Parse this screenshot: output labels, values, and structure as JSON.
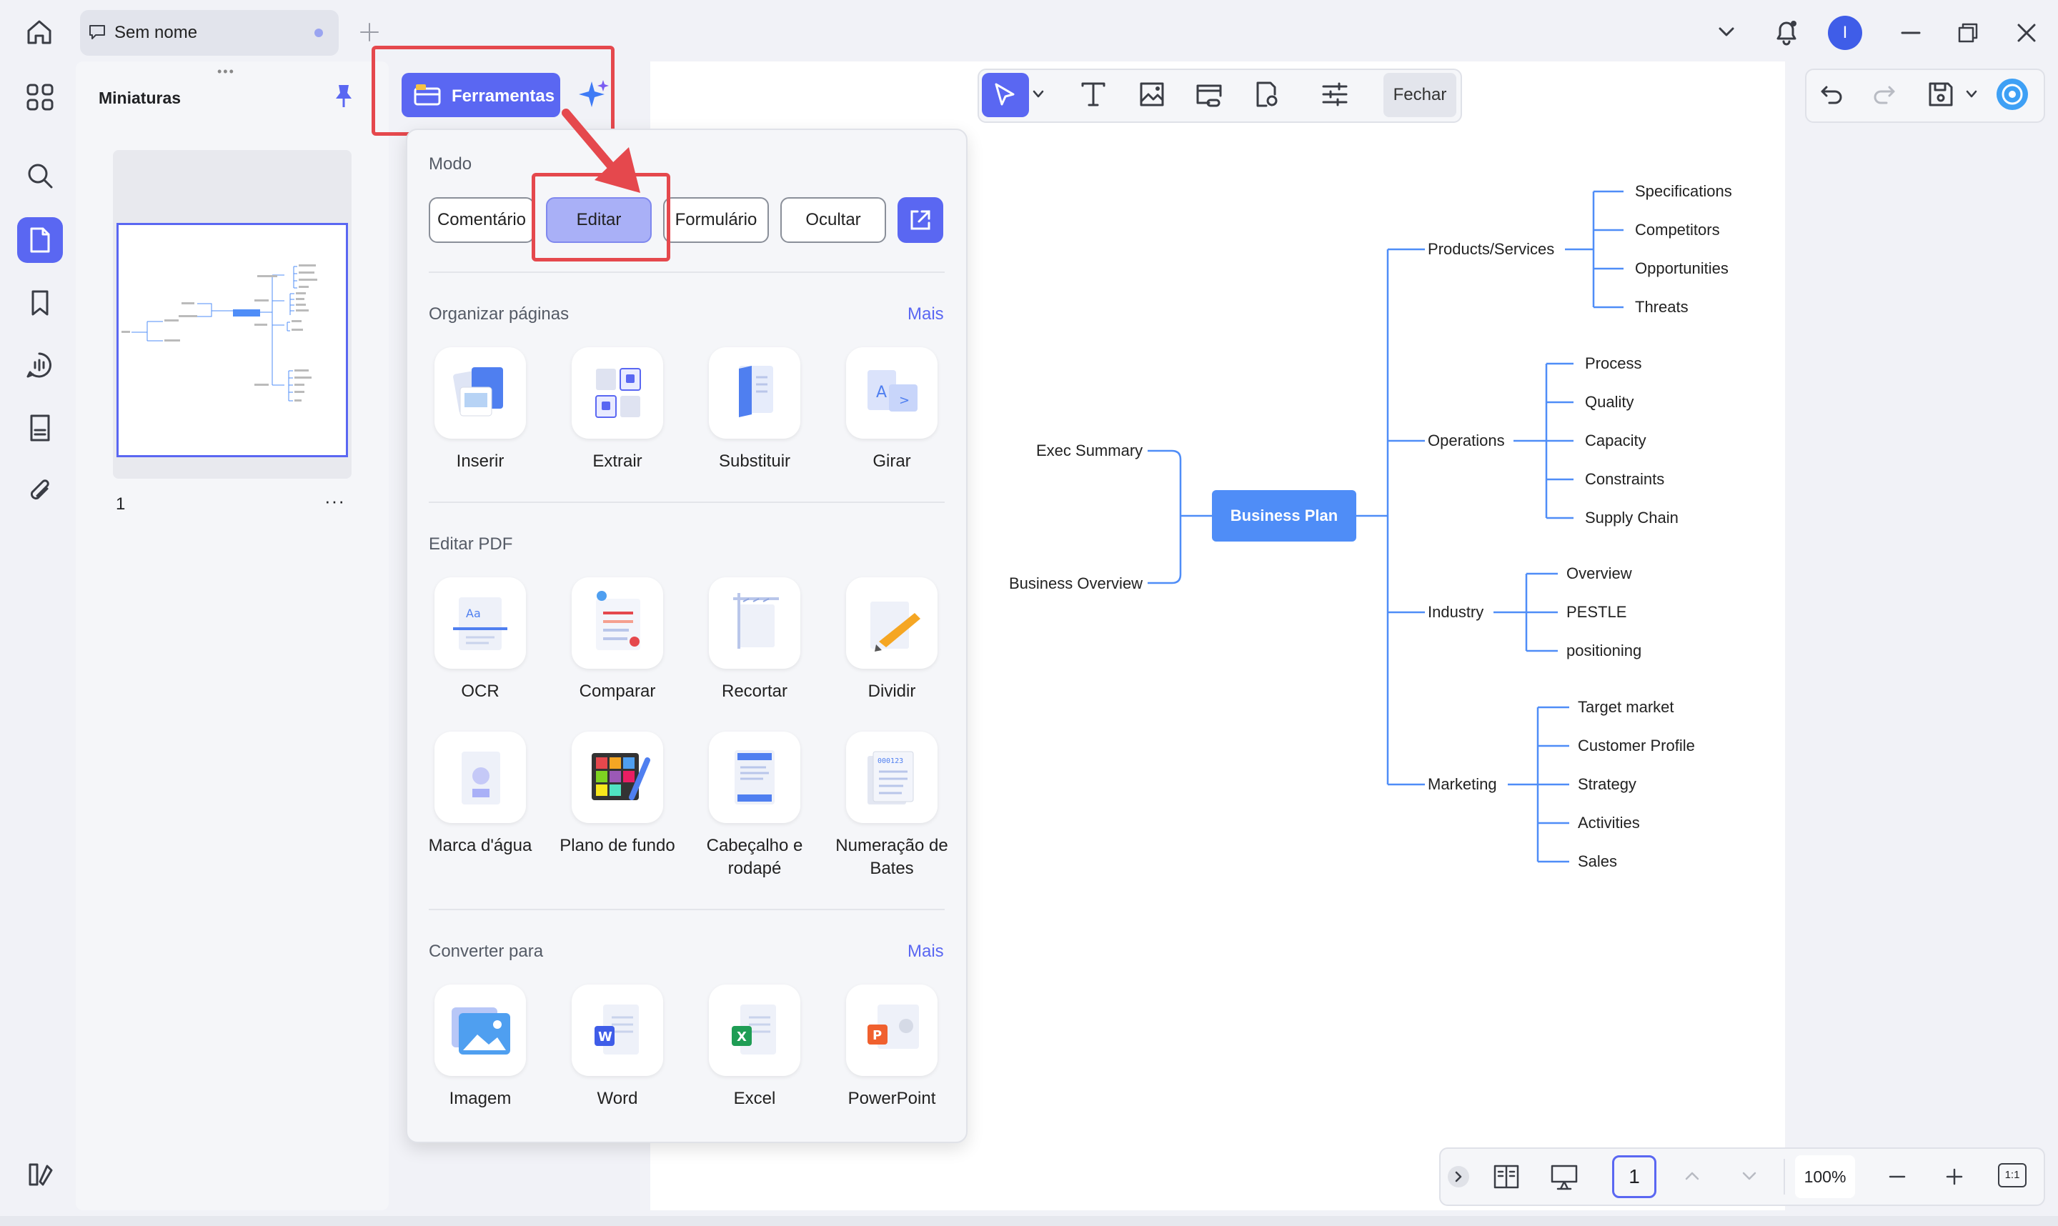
{
  "tab": {
    "title": "Sem nome"
  },
  "user": {
    "initial": "I"
  },
  "thumbnails": {
    "title": "Miniaturas",
    "page_number": "1",
    "more": "···"
  },
  "tools_button": {
    "label": "Ferramentas"
  },
  "edit_toolbar": {
    "close_label": "Fechar"
  },
  "popup": {
    "mode_label": "Modo",
    "modes": [
      "Comentário",
      "Editar",
      "Formulário",
      "Ocultar"
    ],
    "active_mode": "Editar",
    "organize": {
      "label": "Organizar páginas",
      "more": "Mais",
      "items": [
        "Inserir",
        "Extrair",
        "Substituir",
        "Girar"
      ]
    },
    "edit_pdf": {
      "label": "Editar PDF",
      "items": [
        "OCR",
        "Comparar",
        "Recortar",
        "Dividir",
        "Marca d'água",
        "Plano de fundo",
        "Cabeçalho e rodapé",
        "Numeração de Bates"
      ]
    },
    "convert": {
      "label": "Converter para",
      "more": "Mais",
      "items": [
        "Imagem",
        "Word",
        "Excel",
        "PowerPoint"
      ]
    }
  },
  "mindmap": {
    "center": "Business Plan",
    "left": [
      "Exec Summary",
      "Business Overview"
    ],
    "branches": [
      {
        "label": "Products/Services",
        "children": [
          "Specifications",
          "Competitors",
          "Opportunities",
          "Threats"
        ]
      },
      {
        "label": "Operations",
        "children": [
          "Process",
          "Quality",
          "Capacity",
          "Constraints",
          "Supply Chain"
        ]
      },
      {
        "label": "Industry",
        "children": [
          "Overview",
          "PESTLE",
          "positioning"
        ]
      },
      {
        "label": "Marketing",
        "children": [
          "Target market",
          "Customer Profile",
          "Strategy",
          "Activities",
          "Sales"
        ]
      }
    ]
  },
  "bottombar": {
    "page": "1",
    "zoom": "100%",
    "fit": "1:1"
  },
  "colors": {
    "accent": "#5a67f2",
    "highlight": "#e5484d",
    "mindmap_line": "#4f8df7"
  }
}
